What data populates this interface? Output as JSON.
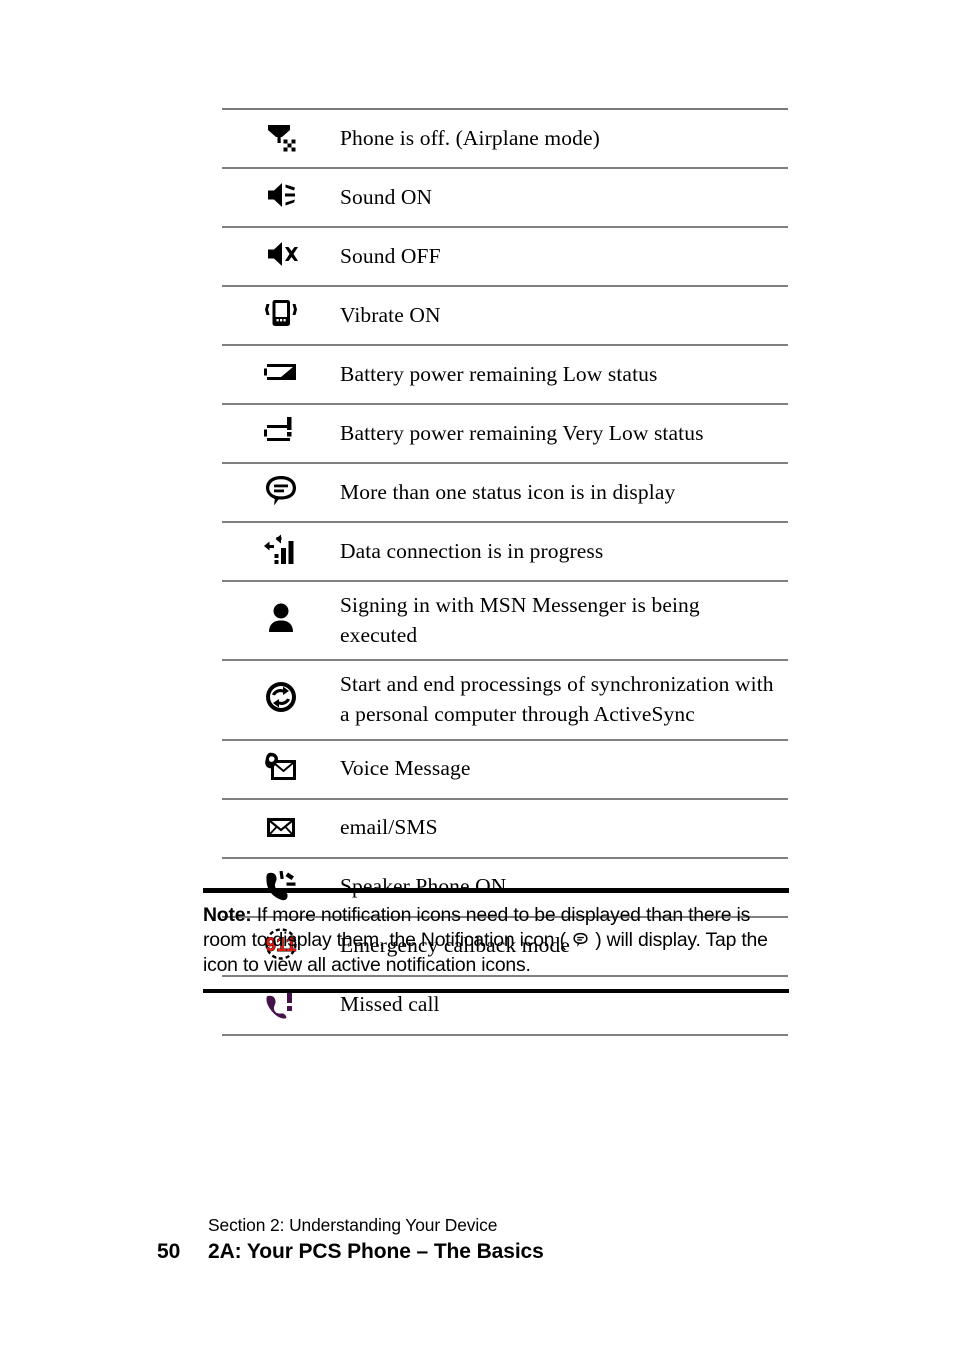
{
  "page": {
    "number": "50",
    "section": "Section 2: Understanding Your Device",
    "title": "2A: Your PCS Phone – The Basics"
  },
  "colors": {
    "rule": "#808080",
    "note_rule": "#000000",
    "emergency_red": "#e8190f",
    "missed_call_purple": "#46124a",
    "icon_black": "#000000"
  },
  "icon_table": {
    "rows": [
      {
        "icon": "airplane-mode-icon",
        "description": "Phone is off. (Airplane mode)"
      },
      {
        "icon": "sound-on-icon",
        "description": "Sound ON"
      },
      {
        "icon": "sound-off-icon",
        "description": "Sound OFF"
      },
      {
        "icon": "vibrate-on-icon",
        "description": "Vibrate ON"
      },
      {
        "icon": "battery-low-icon",
        "description": "Battery power remaining Low status"
      },
      {
        "icon": "battery-very-low-icon",
        "description": "Battery power remaining Very Low status"
      },
      {
        "icon": "notification-bubble-icon",
        "description": "More than one status icon is in display"
      },
      {
        "icon": "data-connection-icon",
        "description": "Data connection is in progress"
      },
      {
        "icon": "messenger-person-icon",
        "description": "Signing in with MSN Messenger is being executed"
      },
      {
        "icon": "activesync-icon",
        "description": "Start and end processings of synchronization with a personal computer through ActiveSync"
      },
      {
        "icon": "voice-message-icon",
        "description": "Voice Message"
      },
      {
        "icon": "email-sms-icon",
        "description": "email/SMS"
      },
      {
        "icon": "speaker-phone-on-icon",
        "description": "Speaker Phone ON"
      },
      {
        "icon": "emergency-callback-icon",
        "description": "Emergency callback mode"
      },
      {
        "icon": "missed-call-icon",
        "description": "Missed call"
      }
    ]
  },
  "note": {
    "label": "Note:",
    "text_before": " If more notification icons need to be displayed than there is room to display them, the Notification icon ( ",
    "text_after": " ) will display. Tap the icon to view all active notification icons.",
    "inline_icon": "notification-bubble-icon"
  }
}
